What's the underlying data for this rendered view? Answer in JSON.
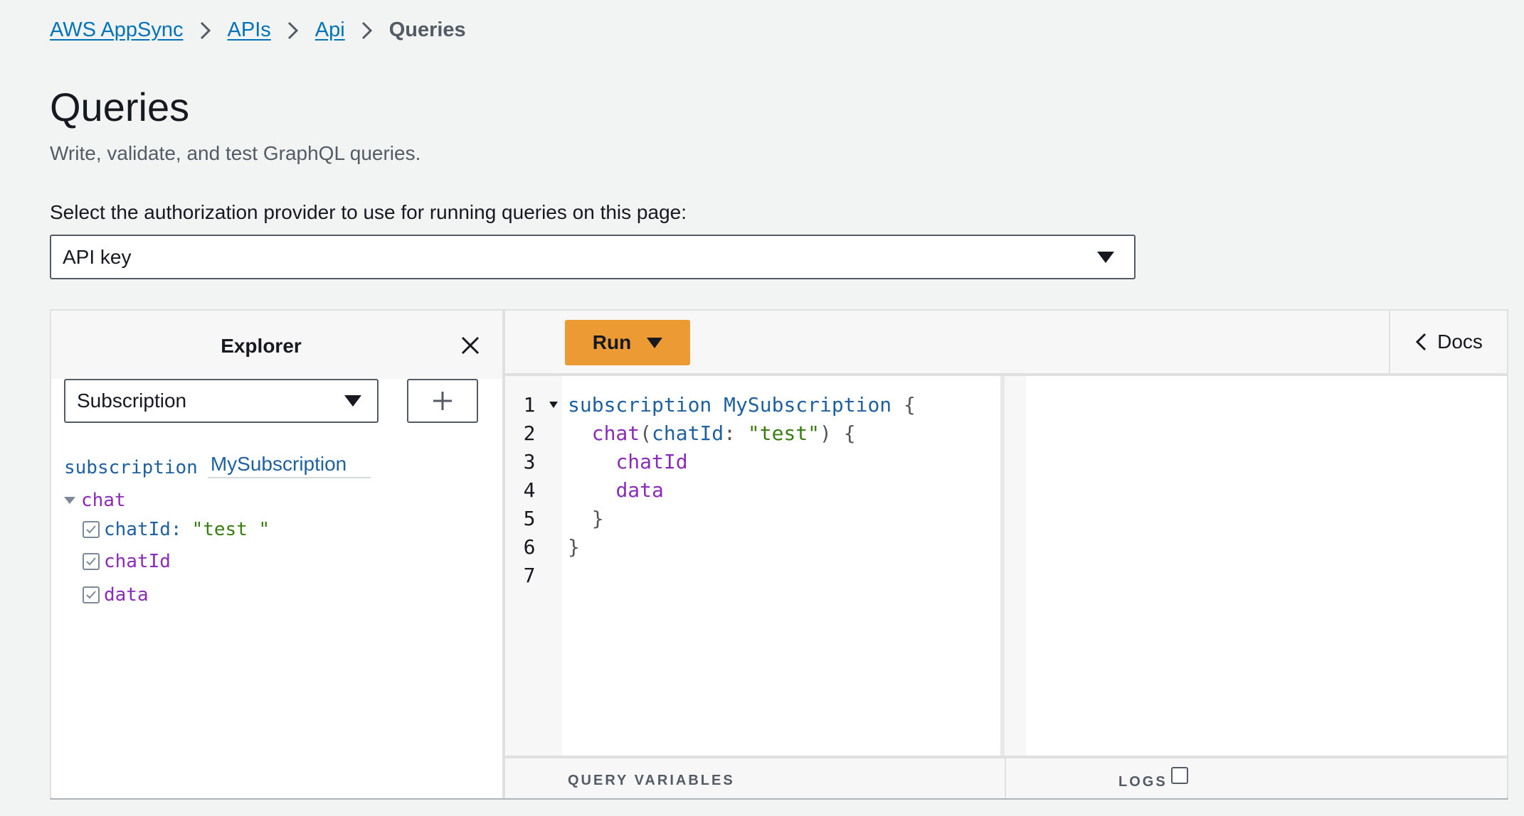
{
  "breadcrumb": {
    "items": [
      "AWS AppSync",
      "APIs",
      "Api"
    ],
    "current": "Queries"
  },
  "page": {
    "title": "Queries",
    "description": "Write, validate, and test GraphQL queries."
  },
  "auth": {
    "label": "Select the authorization provider to use for running queries on this page:",
    "selected": "API key"
  },
  "explorer": {
    "title": "Explorer",
    "operation_type": "Subscription",
    "operation_keyword": "subscription",
    "operation_name": "MySubscription",
    "root_field": "chat",
    "argument_name": "chatId:",
    "argument_value": "\"test  \"",
    "fields": [
      "chatId",
      "data"
    ]
  },
  "toolbar": {
    "run_label": "Run",
    "docs_label": "Docs"
  },
  "editor": {
    "line_numbers": [
      "1",
      "2",
      "3",
      "4",
      "5",
      "6",
      "7"
    ],
    "line1": {
      "kw": "subscription",
      "name": "MySubscription",
      "brace": "{"
    },
    "line2": {
      "field": "chat",
      "open": "(",
      "arg": "chatId",
      "colon": ":",
      "value": "\"test\"",
      "close": ")",
      "brace": "{"
    },
    "line3": "chatId",
    "line4": "data",
    "line5": "}",
    "line6": "}"
  },
  "bottom": {
    "query_variables_label": "QUERY VARIABLES",
    "logs_label": "LOGS"
  },
  "colors": {
    "accent": "#ec9b34",
    "link": "#0073bb",
    "keyword": "#1f61a0",
    "field": "#8b2bb9",
    "string": "#397d13"
  }
}
